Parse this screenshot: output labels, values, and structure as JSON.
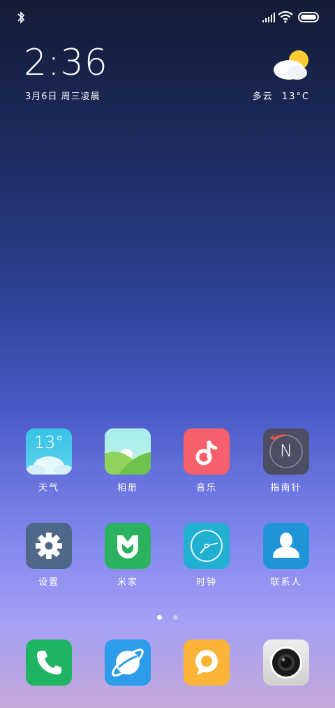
{
  "status_bar": {
    "bluetooth": "bluetooth-icon",
    "signal": "signal-icon",
    "wifi": "wifi-icon",
    "battery": "battery-icon"
  },
  "clock_widget": {
    "time": "2:36",
    "date": "3月6日 周三凌晨"
  },
  "weather_widget": {
    "condition": "多云",
    "temp": "13°C",
    "icon": "partly-cloudy-icon"
  },
  "apps": [
    {
      "label": "天气",
      "icon": "weather-app-icon",
      "temp": "13°"
    },
    {
      "label": "相册",
      "icon": "gallery-icon"
    },
    {
      "label": "音乐",
      "icon": "music-icon"
    },
    {
      "label": "指南针",
      "icon": "compass-icon",
      "letter": "N"
    },
    {
      "label": "设置",
      "icon": "settings-gear-icon"
    },
    {
      "label": "米家",
      "icon": "mijia-icon"
    },
    {
      "label": "时钟",
      "icon": "clock-icon"
    },
    {
      "label": "联系人",
      "icon": "contacts-icon"
    }
  ],
  "page_indicator": {
    "count": 2,
    "active": 1
  },
  "dock": [
    {
      "icon": "phone-icon"
    },
    {
      "icon": "browser-icon"
    },
    {
      "icon": "messages-icon"
    },
    {
      "icon": "camera-icon"
    }
  ],
  "colors": {
    "weather": "#3cc7e6",
    "gallery": "#8fdc8a",
    "music": "#f5606a",
    "compass": "#4c4f62",
    "settings": "#4f6788",
    "mijia": "#2bb25f",
    "clock": "#21b0d1",
    "contacts": "#1f95d8",
    "phone": "#1fb463",
    "browser": "#2d9ceb",
    "messages": "#fbb438",
    "camera": "#e0e0e0"
  }
}
